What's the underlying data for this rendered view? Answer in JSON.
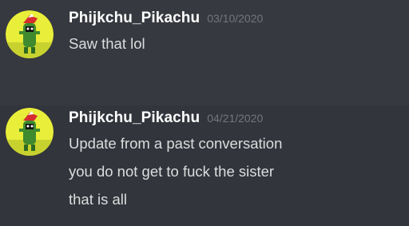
{
  "colors": {
    "background": "#36393f",
    "hover_background": "#32353b",
    "username": "#ffffff",
    "timestamp": "#72767d",
    "message_text": "#dcddde"
  },
  "messages": [
    {
      "avatar_icon": "pikachu-avatar-icon",
      "username": "Phijkchu_Pikachu",
      "timestamp": "03/10/2020",
      "lines": [
        "Saw that lol"
      ]
    },
    {
      "avatar_icon": "pikachu-avatar-icon",
      "username": "Phijkchu_Pikachu",
      "timestamp": "04/21/2020",
      "lines": [
        "Update from a past conversation",
        "you do not get to fuck the sister",
        "that is all"
      ]
    }
  ]
}
